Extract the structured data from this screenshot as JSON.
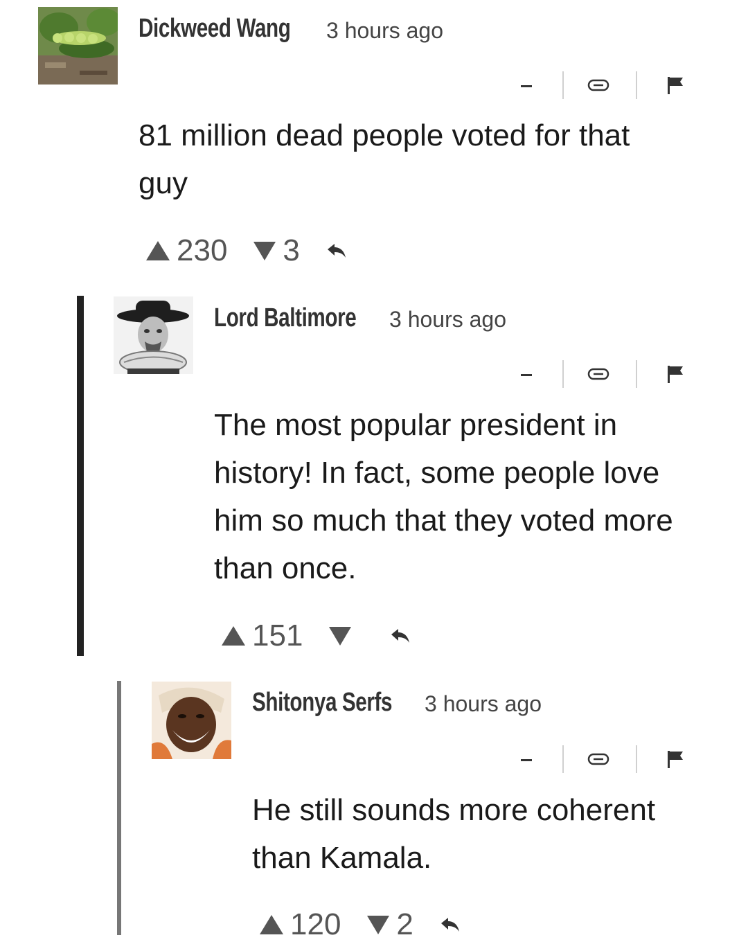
{
  "comments": [
    {
      "author": "Dickweed Wang",
      "timestamp": "3 hours ago",
      "body": "81 million dead people voted for that\nguy",
      "upvotes": "230",
      "downvotes": "3",
      "avatar": "caterpillar-photo"
    },
    {
      "author": "Lord Baltimore",
      "timestamp": "3 hours ago",
      "body": "The most popular president in\nhistory! In fact, some people love\nhim so much that they voted more\nthan once.",
      "upvotes": "151",
      "downvotes": "",
      "avatar": "portrait-engraving"
    },
    {
      "author": "Shitonya Serfs",
      "timestamp": "3 hours ago",
      "body": "He still sounds more coherent\nthan Kamala.",
      "upvotes": "120",
      "downvotes": "2",
      "avatar": "smiling-woman-illustration"
    }
  ],
  "colors": {
    "thread_bar_level1": "#222222",
    "thread_bar_level2": "#777777",
    "meta_text": "#555555"
  },
  "icons": [
    "collapse-icon",
    "link-icon",
    "flag-icon",
    "upvote-icon",
    "downvote-icon",
    "reply-icon"
  ]
}
